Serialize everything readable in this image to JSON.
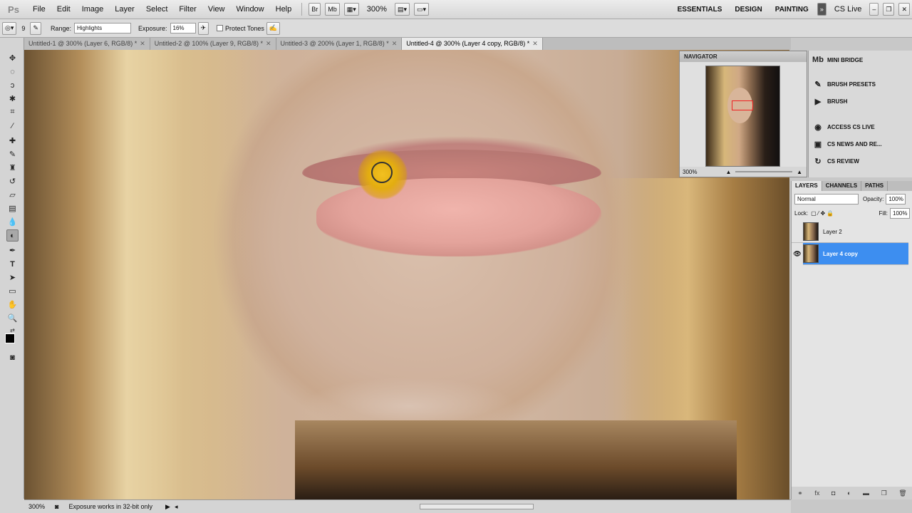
{
  "app": {
    "logo": "Ps"
  },
  "menu": [
    "File",
    "Edit",
    "Image",
    "Layer",
    "Select",
    "Filter",
    "View",
    "Window",
    "Help"
  ],
  "appbar": {
    "br": "Br",
    "mb": "Mb",
    "zoom": "300%"
  },
  "workspaces": [
    "ESSENTIALS",
    "DESIGN",
    "PAINTING"
  ],
  "cslive": "CS Live",
  "options": {
    "brush_size": "9",
    "range_label": "Range:",
    "range_value": "Highlights",
    "exposure_label": "Exposure:",
    "exposure_value": "16%",
    "protect_tones": "Protect Tones"
  },
  "tabs": [
    {
      "label": "Untitled-1 @ 300% (Layer 6, RGB/8) *"
    },
    {
      "label": "Untitled-2 @ 100% (Layer 9, RGB/8) *"
    },
    {
      "label": "Untitled-3 @ 200% (Layer 1, RGB/8) *"
    },
    {
      "label": "Untitled-4 @ 300% (Layer 4 copy, RGB/8) *"
    }
  ],
  "navigator": {
    "title": "NAVIGATOR",
    "zoom": "300%"
  },
  "dock": [
    "MINI BRIDGE",
    "BRUSH PRESETS",
    "BRUSH",
    "ACCESS CS LIVE",
    "CS NEWS AND RE...",
    "CS REVIEW"
  ],
  "layers_panel": {
    "tabs": [
      "LAYERS",
      "CHANNELS",
      "PATHS"
    ],
    "blend_mode": "Normal",
    "opacity_label": "Opacity:",
    "opacity": "100%",
    "lock_label": "Lock:",
    "fill_label": "Fill:",
    "fill": "100%",
    "layers": [
      {
        "name": "Layer 2",
        "visible": false,
        "selected": false
      },
      {
        "name": "Layer 4 copy",
        "visible": true,
        "selected": true
      }
    ]
  },
  "status": {
    "zoom": "300%",
    "message": "Exposure works in 32-bit only"
  },
  "colors": {
    "selection": "#3d8ef0",
    "brush_cursor": "#e3ad10"
  }
}
